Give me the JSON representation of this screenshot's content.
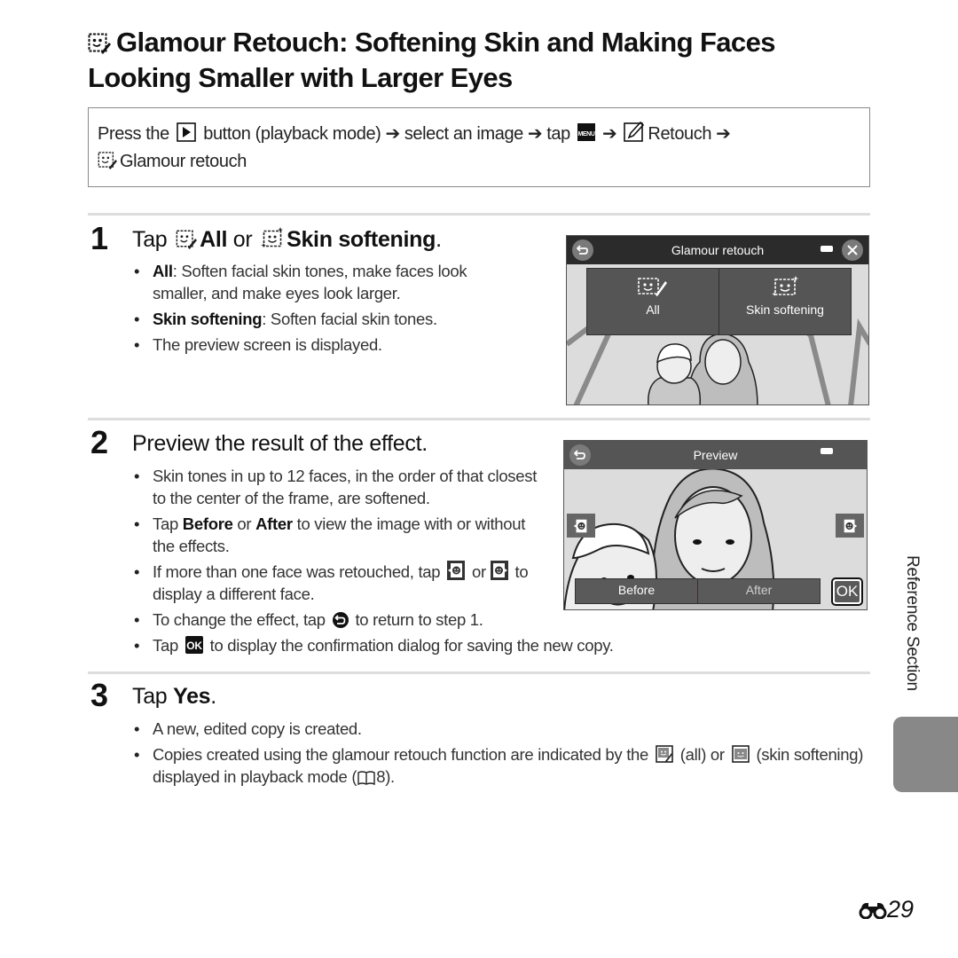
{
  "title": {
    "icon": "glamour-retouch-icon",
    "line1": "Glamour Retouch: Softening Skin and Making Faces",
    "line2": "Looking Smaller with Larger Eyes"
  },
  "navigation": {
    "press_the": "Press the",
    "playback_icon": "play-button-icon",
    "part1": "button (playback mode)",
    "arrow": "➔",
    "part2": "select an image",
    "part3": "tap",
    "menu_icon": "menu-icon",
    "retouch_icon": "retouch-icon",
    "retouch": "Retouch",
    "glamour_icon": "glamour-retouch-icon",
    "glamour_retouch": "Glamour retouch"
  },
  "steps": [
    {
      "number": "1",
      "title_prefix": "Tap",
      "title_all": "All",
      "title_or": "or",
      "title_skin": "Skin softening",
      "title_suffix": ".",
      "bullets": [
        {
          "bold": "All",
          "text": ": Soften facial skin tones, make faces look smaller, and make eyes look larger."
        },
        {
          "bold": "Skin softening",
          "text": ": Soften facial skin tones."
        },
        {
          "bold": "",
          "text": "The preview screen is displayed."
        }
      ],
      "screen": {
        "title": "Glamour retouch",
        "back_icon": "back-icon",
        "battery_icon": "battery-icon",
        "close_icon": "close-icon",
        "options": [
          {
            "label": "All",
            "icon": "glamour-all-icon"
          },
          {
            "label": "Skin softening",
            "icon": "skin-softening-icon"
          }
        ]
      }
    },
    {
      "number": "2",
      "title": "Preview the result of the effect.",
      "bullets": [
        {
          "text": "Skin tones in up to 12 faces, in the order of that closest to the center of the frame, are softened."
        },
        {
          "pre": "Tap ",
          "bold1": "Before",
          "mid": " or ",
          "bold2": "After",
          "post": " to view the image with or without the effects."
        },
        {
          "pre": "If more than one face was retouched, tap",
          "mid": "or",
          "post": "to display a different face."
        },
        {
          "pre": "To change the effect, tap",
          "post": "to return to step 1."
        },
        {
          "pre": "Tap",
          "post": "to display the confirmation dialog for saving the new copy."
        }
      ],
      "screen": {
        "title": "Preview",
        "back_icon": "back-icon",
        "battery_icon": "battery-icon",
        "before_label": "Before",
        "after_label": "After",
        "ok_label": "OK",
        "prev_face_icon": "previous-face-icon",
        "next_face_icon": "next-face-icon"
      }
    },
    {
      "number": "3",
      "title_prefix": "Tap",
      "title_bold": "Yes",
      "title_suffix": ".",
      "bullets": [
        {
          "text": "A new, edited copy is created."
        },
        {
          "pre": "Copies created using the glamour retouch function are indicated by the",
          "mid": "(all) or",
          "post": "(skin softening) displayed in playback mode (",
          "ref": "8",
          "end": ")."
        }
      ]
    }
  ],
  "side_tab": {
    "label": "Reference Section"
  },
  "page_number": {
    "icon": "reference-binoculars-icon",
    "number": "29"
  }
}
